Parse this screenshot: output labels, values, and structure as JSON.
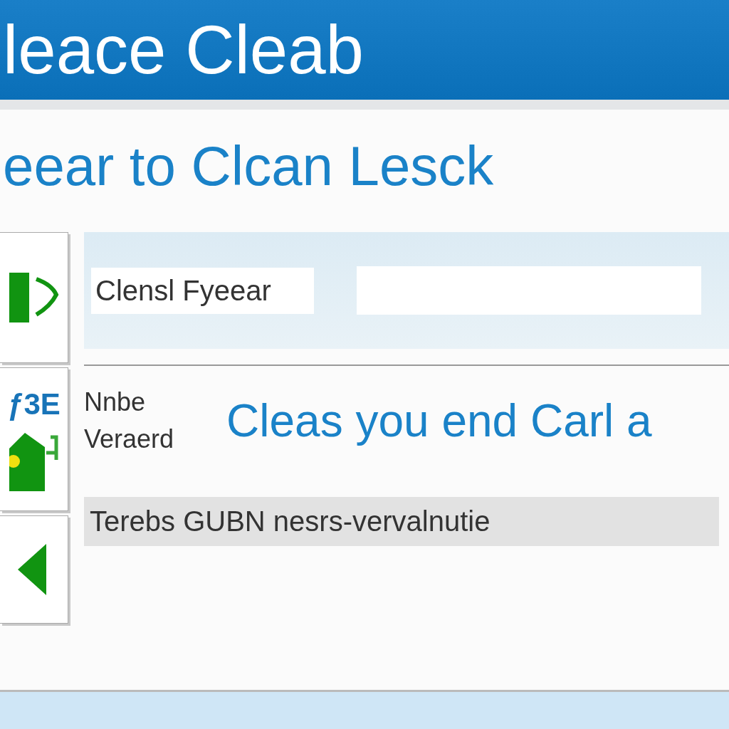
{
  "header": {
    "title": "leace Cleab"
  },
  "heading": "eear to Clcan Lesck",
  "side_tiles": [
    {
      "kind": "play"
    },
    {
      "kind": "house",
      "label": "ƒ3E"
    },
    {
      "kind": "back"
    }
  ],
  "search": {
    "label": "Clensl Fyeear"
  },
  "fields": [
    {
      "label": "Nnbe"
    },
    {
      "label": "Veraerd"
    }
  ],
  "banner": "Cleas you end Carl a",
  "status_bar": {
    "text": "Terebs GUBN nesrs-vervalnutie"
  }
}
